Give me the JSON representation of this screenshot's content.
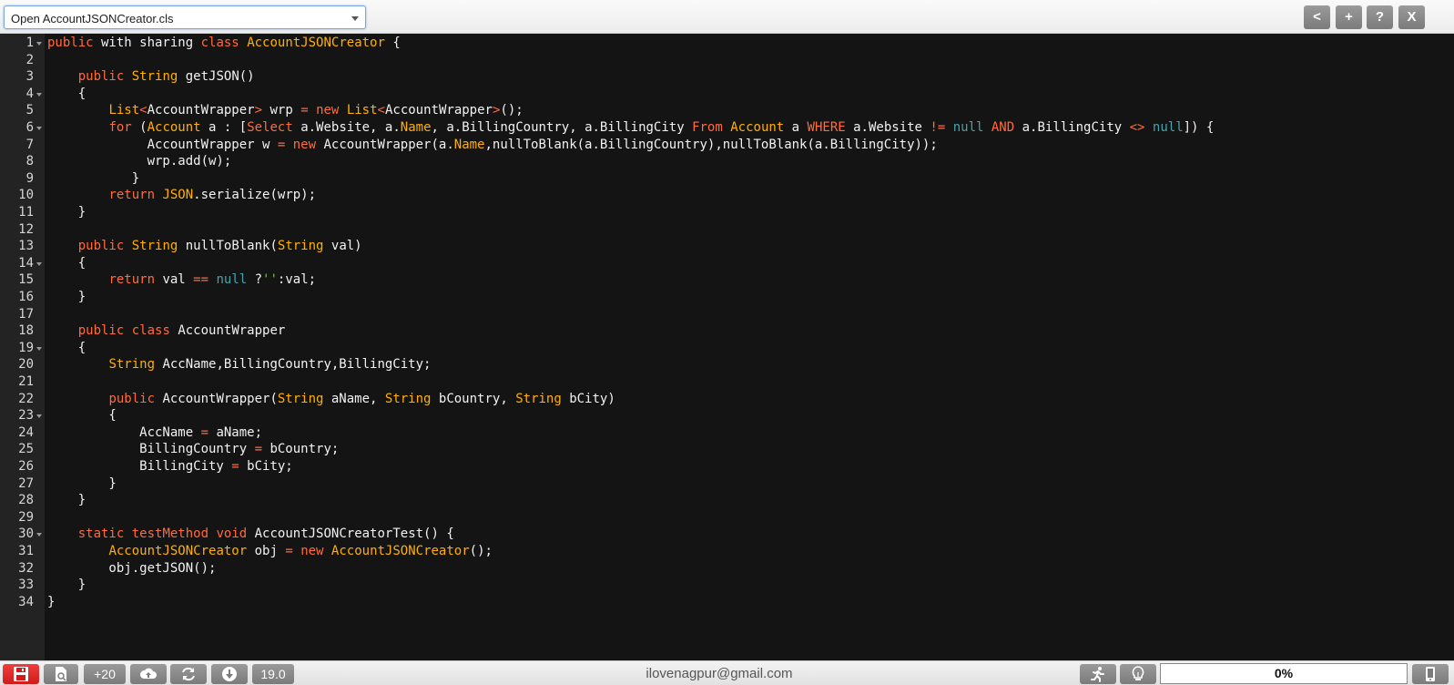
{
  "toolbar": {
    "file_select_value": "Open AccountJSONCreator.cls",
    "buttons": [
      "<",
      "+",
      "?",
      "X"
    ]
  },
  "editor": {
    "line_numbers": [
      "1",
      "2",
      "3",
      "4",
      "5",
      "6",
      "7",
      "8",
      "9",
      "10",
      "11",
      "12",
      "13",
      "14",
      "15",
      "16",
      "17",
      "18",
      "19",
      "20",
      "21",
      "22",
      "23",
      "24",
      "25",
      "26",
      "27",
      "28",
      "29",
      "30",
      "31",
      "32",
      "33",
      "34"
    ],
    "fold_lines": [
      1,
      4,
      6,
      14,
      19,
      23,
      30
    ],
    "lines": [
      [
        [
          "kw",
          "public"
        ],
        [
          "p",
          " with sharing "
        ],
        [
          "kw",
          "class"
        ],
        [
          "p",
          " "
        ],
        [
          "type",
          "AccountJSONCreator"
        ],
        [
          "p",
          " {"
        ]
      ],
      [],
      [
        [
          "p",
          "    "
        ],
        [
          "kw",
          "public"
        ],
        [
          "p",
          " "
        ],
        [
          "type",
          "String"
        ],
        [
          "p",
          " getJSON()"
        ]
      ],
      [
        [
          "p",
          "    {"
        ]
      ],
      [
        [
          "p",
          "        "
        ],
        [
          "type",
          "List"
        ],
        [
          "op",
          "<"
        ],
        [
          "p",
          "AccountWrapper"
        ],
        [
          "op",
          ">"
        ],
        [
          "p",
          " wrp "
        ],
        [
          "op",
          "="
        ],
        [
          "p",
          " "
        ],
        [
          "kw",
          "new"
        ],
        [
          "p",
          " "
        ],
        [
          "type",
          "List"
        ],
        [
          "op",
          "<"
        ],
        [
          "p",
          "AccountWrapper"
        ],
        [
          "op",
          ">"
        ],
        [
          "p",
          "();"
        ]
      ],
      [
        [
          "p",
          "        "
        ],
        [
          "kw",
          "for"
        ],
        [
          "p",
          " ("
        ],
        [
          "type",
          "Account"
        ],
        [
          "p",
          " a : ["
        ],
        [
          "kw",
          "Select"
        ],
        [
          "p",
          " a.Website, a."
        ],
        [
          "type",
          "Name"
        ],
        [
          "p",
          ", a.BillingCountry, a.BillingCity "
        ],
        [
          "kw",
          "From"
        ],
        [
          "p",
          " "
        ],
        [
          "type",
          "Account"
        ],
        [
          "p",
          " a "
        ],
        [
          "kw",
          "WHERE"
        ],
        [
          "p",
          " a.Website "
        ],
        [
          "op",
          "!="
        ],
        [
          "p",
          " "
        ],
        [
          "null",
          "null"
        ],
        [
          "p",
          " "
        ],
        [
          "kw",
          "AND"
        ],
        [
          "p",
          " a.BillingCity "
        ],
        [
          "op",
          "<>"
        ],
        [
          "p",
          " "
        ],
        [
          "null",
          "null"
        ],
        [
          "p",
          "]) {"
        ]
      ],
      [
        [
          "p",
          "             AccountWrapper w "
        ],
        [
          "op",
          "="
        ],
        [
          "p",
          " "
        ],
        [
          "kw",
          "new"
        ],
        [
          "p",
          " AccountWrapper(a."
        ],
        [
          "type",
          "Name"
        ],
        [
          "p",
          ",nullToBlank(a.BillingCountry),nullToBlank(a.BillingCity));"
        ]
      ],
      [
        [
          "p",
          "             wrp.add(w);"
        ]
      ],
      [
        [
          "p",
          "           }"
        ]
      ],
      [
        [
          "p",
          "        "
        ],
        [
          "kw",
          "return"
        ],
        [
          "p",
          " "
        ],
        [
          "type",
          "JSON"
        ],
        [
          "p",
          ".serialize(wrp);"
        ]
      ],
      [
        [
          "p",
          "    }"
        ]
      ],
      [],
      [
        [
          "p",
          "    "
        ],
        [
          "kw",
          "public"
        ],
        [
          "p",
          " "
        ],
        [
          "type",
          "String"
        ],
        [
          "p",
          " nullToBlank("
        ],
        [
          "type",
          "String"
        ],
        [
          "p",
          " val)"
        ]
      ],
      [
        [
          "p",
          "    {"
        ]
      ],
      [
        [
          "p",
          "        "
        ],
        [
          "kw",
          "return"
        ],
        [
          "p",
          " val "
        ],
        [
          "op",
          "=="
        ],
        [
          "p",
          " "
        ],
        [
          "null",
          "null"
        ],
        [
          "p",
          " ?"
        ],
        [
          "str",
          "''"
        ],
        [
          "p",
          ":val;"
        ]
      ],
      [
        [
          "p",
          "    }"
        ]
      ],
      [],
      [
        [
          "p",
          "    "
        ],
        [
          "kw",
          "public"
        ],
        [
          "p",
          " "
        ],
        [
          "kw",
          "class"
        ],
        [
          "p",
          " AccountWrapper"
        ]
      ],
      [
        [
          "p",
          "    {"
        ]
      ],
      [
        [
          "p",
          "        "
        ],
        [
          "type",
          "String"
        ],
        [
          "p",
          " AccName,BillingCountry,BillingCity;"
        ]
      ],
      [],
      [
        [
          "p",
          "        "
        ],
        [
          "kw",
          "public"
        ],
        [
          "p",
          " AccountWrapper("
        ],
        [
          "type",
          "String"
        ],
        [
          "p",
          " aName, "
        ],
        [
          "type",
          "String"
        ],
        [
          "p",
          " bCountry, "
        ],
        [
          "type",
          "String"
        ],
        [
          "p",
          " bCity)"
        ]
      ],
      [
        [
          "p",
          "        {"
        ]
      ],
      [
        [
          "p",
          "            AccName "
        ],
        [
          "op",
          "="
        ],
        [
          "p",
          " aName;"
        ]
      ],
      [
        [
          "p",
          "            BillingCountry "
        ],
        [
          "op",
          "="
        ],
        [
          "p",
          " bCountry;"
        ]
      ],
      [
        [
          "p",
          "            BillingCity "
        ],
        [
          "op",
          "="
        ],
        [
          "p",
          " bCity;"
        ]
      ],
      [
        [
          "p",
          "        }"
        ]
      ],
      [
        [
          "p",
          "    }"
        ]
      ],
      [],
      [
        [
          "p",
          "    "
        ],
        [
          "kw",
          "static"
        ],
        [
          "p",
          " "
        ],
        [
          "kw",
          "testMethod"
        ],
        [
          "p",
          " "
        ],
        [
          "kw",
          "void"
        ],
        [
          "p",
          " AccountJSONCreatorTest() {"
        ]
      ],
      [
        [
          "p",
          "        "
        ],
        [
          "type",
          "AccountJSONCreator"
        ],
        [
          "p",
          " obj "
        ],
        [
          "op",
          "="
        ],
        [
          "p",
          " "
        ],
        [
          "kw",
          "new"
        ],
        [
          "p",
          " "
        ],
        [
          "type",
          "AccountJSONCreator"
        ],
        [
          "p",
          "();"
        ]
      ],
      [
        [
          "p",
          "        obj.getJSON();"
        ]
      ],
      [
        [
          "p",
          "    }"
        ]
      ],
      [
        [
          "p",
          "}"
        ]
      ]
    ]
  },
  "statusbar": {
    "plus_label": "+20",
    "version_label": "19.0",
    "email": "ilovenagpur@gmail.com",
    "progress_text": "0%",
    "progress_value": 0
  },
  "icons": {
    "save": "save-icon",
    "search_file": "file-search-icon",
    "cloud": "cloud-upload-icon",
    "refresh": "refresh-icon",
    "download": "download-icon",
    "run": "running-person-icon",
    "hint": "lightbulb-icon",
    "mobile": "mobile-icon"
  },
  "colors": {
    "keyword": "#ff6b3d",
    "type": "#ffb000",
    "null_literal": "#46a3ab",
    "string_literal": "#75c44d",
    "save_button": "#e12a2a"
  }
}
